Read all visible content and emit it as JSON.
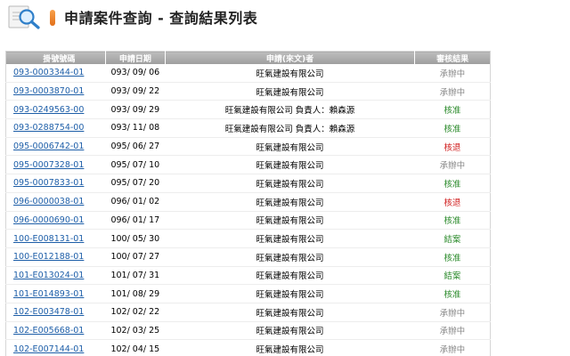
{
  "header": {
    "title": "申請案件查詢 - 查詢結果列表",
    "icon": "search-magnifier-icon",
    "marker_icon": "title-marker-icon"
  },
  "colors": {
    "link": "#1d5ea8",
    "header_bg": "#a8a8a8",
    "status_pending": "#8a8a8a",
    "status_approved": "#2a8a2a",
    "status_rejected": "#d01c1c",
    "accent_orange": "#e2701a"
  },
  "table": {
    "columns": [
      "掛號號碼",
      "申請日期",
      "申請(來文)者",
      "審核結果"
    ],
    "rows": [
      {
        "case_no": "093-0003344-01",
        "date": "093/ 09/ 06",
        "applicant": "旺氣建設有限公司",
        "result": "承辦中",
        "status": "pending"
      },
      {
        "case_no": "093-0003870-01",
        "date": "093/ 09/ 22",
        "applicant": "旺氣建設有限公司",
        "result": "承辦中",
        "status": "pending"
      },
      {
        "case_no": "093-0249563-00",
        "date": "093/ 09/ 29",
        "applicant": "旺氣建設有限公司 負責人：賴森源",
        "result": "核准",
        "status": "approved"
      },
      {
        "case_no": "093-0288754-00",
        "date": "093/ 11/ 08",
        "applicant": "旺氣建設有限公司 負責人：賴森源",
        "result": "核准",
        "status": "approved"
      },
      {
        "case_no": "095-0006742-01",
        "date": "095/ 06/ 27",
        "applicant": "旺氣建設有限公司",
        "result": "核退",
        "status": "rejected"
      },
      {
        "case_no": "095-0007328-01",
        "date": "095/ 07/ 10",
        "applicant": "旺氣建設有限公司",
        "result": "承辦中",
        "status": "pending"
      },
      {
        "case_no": "095-0007833-01",
        "date": "095/ 07/ 20",
        "applicant": "旺氣建設有限公司",
        "result": "核准",
        "status": "approved"
      },
      {
        "case_no": "096-0000038-01",
        "date": "096/ 01/ 02",
        "applicant": "旺氣建設有限公司",
        "result": "核退",
        "status": "rejected"
      },
      {
        "case_no": "096-0000690-01",
        "date": "096/ 01/ 17",
        "applicant": "旺氣建設有限公司",
        "result": "核准",
        "status": "approved"
      },
      {
        "case_no": "100-E008131-01",
        "date": "100/ 05/ 30",
        "applicant": "旺氣建設有限公司",
        "result": "結案",
        "status": "closed"
      },
      {
        "case_no": "100-E012188-01",
        "date": "100/ 07/ 27",
        "applicant": "旺氣建設有限公司",
        "result": "核准",
        "status": "approved"
      },
      {
        "case_no": "101-E013024-01",
        "date": "101/ 07/ 31",
        "applicant": "旺氣建設有限公司",
        "result": "結案",
        "status": "closed"
      },
      {
        "case_no": "101-E014893-01",
        "date": "101/ 08/ 29",
        "applicant": "旺氣建設有限公司",
        "result": "核准",
        "status": "approved"
      },
      {
        "case_no": "102-E003478-01",
        "date": "102/ 02/ 22",
        "applicant": "旺氣建設有限公司",
        "result": "承辦中",
        "status": "pending"
      },
      {
        "case_no": "102-E005668-01",
        "date": "102/ 03/ 25",
        "applicant": "旺氣建設有限公司",
        "result": "承辦中",
        "status": "pending"
      },
      {
        "case_no": "102-E007144-01",
        "date": "102/ 04/ 15",
        "applicant": "旺氣建設有限公司",
        "result": "承辦中",
        "status": "pending"
      }
    ]
  }
}
